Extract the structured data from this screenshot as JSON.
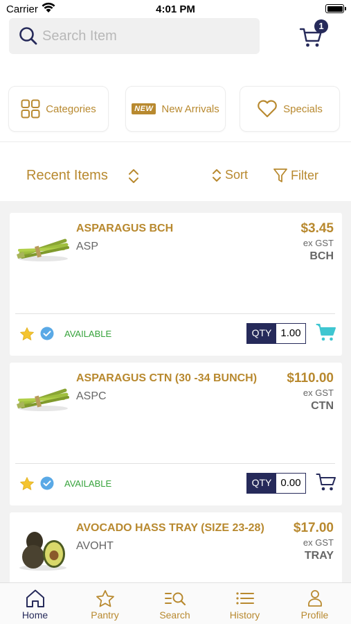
{
  "status": {
    "carrier": "Carrier",
    "time": "4:01 PM"
  },
  "search": {
    "placeholder": "Search Item",
    "value": ""
  },
  "cart": {
    "badge": "1"
  },
  "quick_links": [
    {
      "label": "Categories",
      "icon": "grid-icon"
    },
    {
      "tag": "NEW",
      "label": "New Arrivals",
      "icon": "new-tag-icon"
    },
    {
      "label": "Specials",
      "icon": "heart-icon"
    }
  ],
  "list": {
    "title": "Recent Items",
    "sort_label": "Sort",
    "filter_label": "Filter"
  },
  "products": [
    {
      "name": "ASPARAGUS BCH",
      "code": "ASP",
      "price": "$3.45",
      "tax": "ex GST",
      "unit": "BCH",
      "status": "AVAILABLE",
      "qty_label": "QTY",
      "qty": "1.00",
      "image": "asparagus-image",
      "in_cart": true
    },
    {
      "name": "ASPARAGUS CTN (30 -34 BUNCH)",
      "code": "ASPC",
      "price": "$110.00",
      "tax": "ex GST",
      "unit": "CTN",
      "status": "AVAILABLE",
      "qty_label": "QTY",
      "qty": "0.00",
      "image": "asparagus-image",
      "in_cart": false
    },
    {
      "name": "AVOCADO HASS TRAY (SIZE 23-28)",
      "code": "AVOHT",
      "price": "$17.00",
      "tax": "ex GST",
      "unit": "TRAY",
      "image": "avocado-image"
    }
  ],
  "tabs": [
    {
      "label": "Home",
      "icon": "home-icon",
      "active": true
    },
    {
      "label": "Pantry",
      "icon": "star-icon",
      "active": false
    },
    {
      "label": "Search",
      "icon": "search-list-icon",
      "active": false
    },
    {
      "label": "History",
      "icon": "list-icon",
      "active": false
    },
    {
      "label": "Profile",
      "icon": "person-icon",
      "active": false
    }
  ],
  "colors": {
    "accent_gold": "#b8892f",
    "navy": "#262a5a",
    "available_green": "#37a33c",
    "cart_teal": "#3fc6d1",
    "star_yellow": "#f4c430",
    "check_blue": "#5aa9e6"
  }
}
